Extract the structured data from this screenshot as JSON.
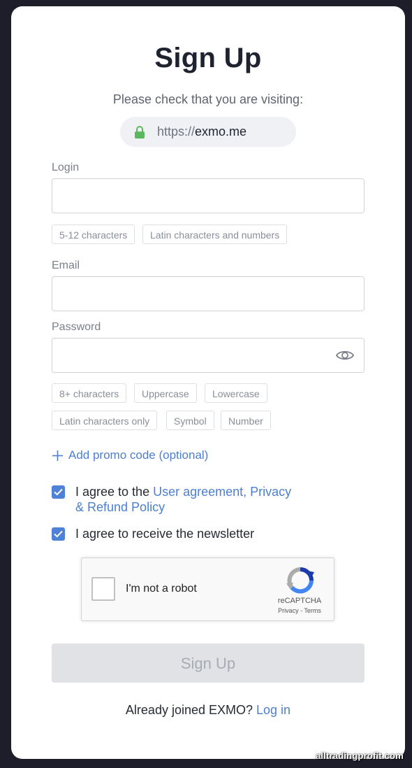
{
  "title": "Sign Up",
  "visiting_notice": "Please check that you are visiting:",
  "url": {
    "protocol": "https://",
    "host": "exmo.me"
  },
  "login": {
    "label": "Login",
    "value": "",
    "hints": [
      "5-12 characters",
      "Latin characters and numbers"
    ]
  },
  "email": {
    "label": "Email",
    "value": ""
  },
  "password": {
    "label": "Password",
    "value": "",
    "hints": [
      "8+ characters",
      "Uppercase",
      "Lowercase",
      "Latin characters only",
      "Symbol",
      "Number"
    ]
  },
  "promo": {
    "label": "Add promo code (optional)"
  },
  "agreements": {
    "terms": {
      "checked": true,
      "prefix": "I agree to the ",
      "link_line1": "User agreement, Privacy",
      "link_line2": "& Refund Policy"
    },
    "newsletter": {
      "checked": true,
      "text": "I agree to receive the newsletter"
    }
  },
  "recaptcha": {
    "label": "I'm not a robot",
    "brand": "reCAPTCHA",
    "privacy": "Privacy",
    "sep": " - ",
    "terms": "Terms"
  },
  "submit": {
    "label": "Sign Up",
    "enabled": false
  },
  "footer": {
    "text": "Already joined EXMO? ",
    "link": "Log in"
  },
  "watermark": "alltradingprofit.com",
  "colors": {
    "accent": "#4d7fd1",
    "checkbox": "#4d82d6",
    "lock": "#5cb85c",
    "background": "#1e1e2a"
  }
}
